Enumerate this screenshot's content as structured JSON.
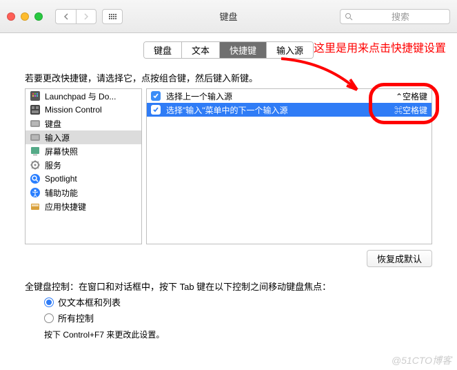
{
  "titlebar": {
    "title": "键盘",
    "search_placeholder": "搜索"
  },
  "tabs": [
    "键盘",
    "文本",
    "快捷键",
    "输入源"
  ],
  "active_tab": 2,
  "hint": "若要更改快捷键，请选择它，点按组合键，然后键入新键。",
  "categories": [
    {
      "icon": "launchpad",
      "label": "Launchpad 与 Do..."
    },
    {
      "icon": "mission",
      "label": "Mission Control"
    },
    {
      "icon": "keyboard",
      "label": "键盘"
    },
    {
      "icon": "input",
      "label": "输入源",
      "selected": true
    },
    {
      "icon": "screenshot",
      "label": "屏幕快照"
    },
    {
      "icon": "services",
      "label": "服务"
    },
    {
      "icon": "spotlight",
      "label": "Spotlight"
    },
    {
      "icon": "accessibility",
      "label": "辅助功能"
    },
    {
      "icon": "appshortcut",
      "label": "应用快捷键"
    }
  ],
  "shortcuts": [
    {
      "checked": true,
      "label": "选择上一个输入源",
      "keys": "⌃空格键",
      "selected": false
    },
    {
      "checked": true,
      "label": "选择\"输入\"菜单中的下一个输入源",
      "keys": "⌘空格键",
      "selected": true
    }
  ],
  "restore_label": "恢复成默认",
  "fka_label": "全键盘控制：在窗口和对话框中，按下 Tab 键在以下控制之间移动键盘焦点：",
  "fka_options": [
    "仅文本框和列表",
    "所有控制"
  ],
  "fka_selected": 0,
  "fka_note": "按下 Control+F7 来更改此设置。",
  "annotation": "这里是用来点击快捷键设置",
  "watermark": "@51CTO博客"
}
